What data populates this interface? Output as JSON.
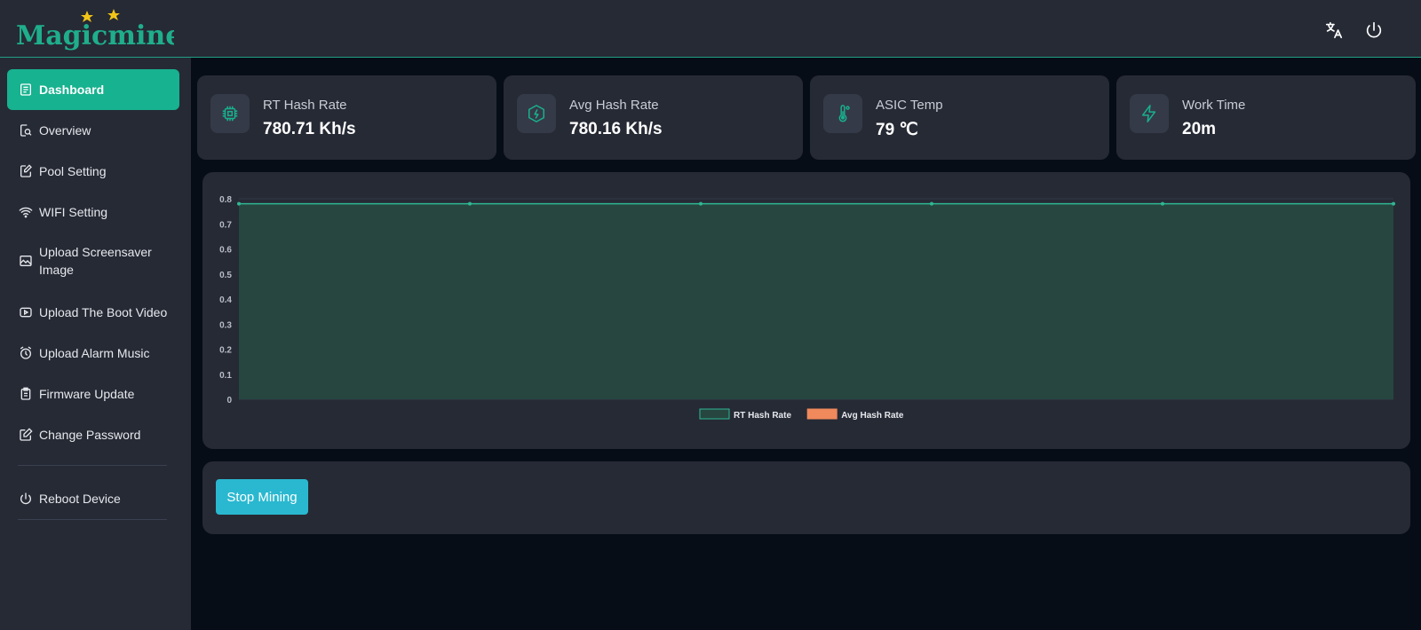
{
  "header": {
    "logo_text": "Magicminer",
    "translate_icon": "translate-icon",
    "power_icon": "power-icon"
  },
  "sidebar": {
    "items": [
      {
        "label": "Dashboard",
        "icon": "list-icon",
        "active": true
      },
      {
        "label": "Overview",
        "icon": "search-document-icon"
      },
      {
        "label": "Pool Setting",
        "icon": "edit-document-icon"
      },
      {
        "label": "WIFI Setting",
        "icon": "wifi-icon"
      },
      {
        "label": "Upload Screensaver Image",
        "icon": "image-icon"
      },
      {
        "label": "Upload The Boot Video",
        "icon": "video-icon"
      },
      {
        "label": "Upload Alarm Music",
        "icon": "alarm-clock-icon"
      },
      {
        "label": "Firmware Update",
        "icon": "clipboard-icon"
      },
      {
        "label": "Change Password",
        "icon": "edit-icon"
      },
      {
        "label": "Reboot Device",
        "icon": "power-icon"
      }
    ]
  },
  "stats": [
    {
      "label": "RT Hash Rate",
      "value": "780.71 Kh/s",
      "icon": "chip-icon"
    },
    {
      "label": "Avg Hash Rate",
      "value": "780.16 Kh/s",
      "icon": "hexagon-bolt-icon"
    },
    {
      "label": "ASIC Temp",
      "value": "79 ℃",
      "icon": "thermometer-icon"
    },
    {
      "label": "Work Time",
      "value": "20m",
      "icon": "bolt-icon"
    }
  ],
  "colors": {
    "accent": "#17b28f",
    "rt_series": "#1f8a72",
    "avg_series": "#f0895c",
    "button": "#2ab8d0"
  },
  "chart_data": {
    "type": "area",
    "x": [
      0,
      1,
      2,
      3,
      4,
      5
    ],
    "series": [
      {
        "name": "RT Hash Rate",
        "values": [
          0.78,
          0.78,
          0.78,
          0.78,
          0.78,
          0.78
        ]
      },
      {
        "name": "Avg Hash Rate",
        "values": [
          0.78,
          0.78,
          0.78,
          0.78,
          0.78,
          0.78
        ]
      }
    ],
    "ylim": [
      0,
      0.8
    ],
    "yticks": [
      "0",
      "0.1",
      "0.2",
      "0.3",
      "0.4",
      "0.5",
      "0.6",
      "0.7",
      "0.8"
    ],
    "legend": "bottom",
    "grid": true
  },
  "actions": {
    "stop_label": "Stop Mining"
  }
}
